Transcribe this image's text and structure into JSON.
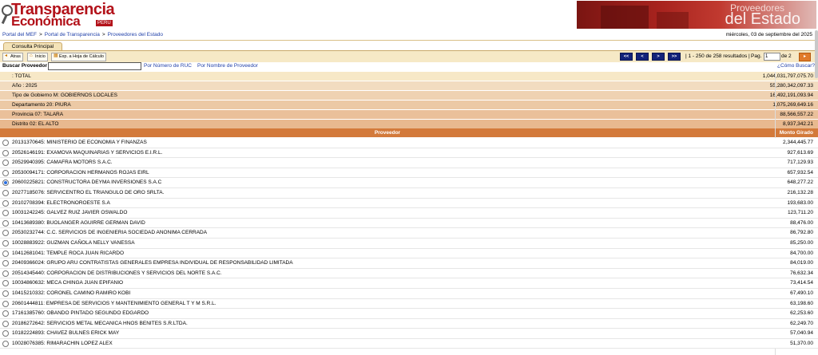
{
  "logo": {
    "line1": "Transparencia",
    "line2": "Económica",
    "tag": "PERU"
  },
  "banner": {
    "line1": "Proveedores",
    "line2": "del Estado"
  },
  "breadcrumb": {
    "items": [
      "Portal del MEF",
      "Portal de Transparencia",
      "Proveedores del Estado"
    ],
    "separator": ">"
  },
  "date": "miércoles, 03 de septiembre del 2025",
  "tab_label": "Consulta Principal",
  "toolbar": {
    "back_label": "Atras",
    "home_label": "Inicio",
    "export_label": "Exp. a Hoja de Cálculo",
    "first": "<<",
    "prev": "<",
    "next": ">",
    "last": ">>",
    "range_text": "| 1 - 250 de 258 resultados |",
    "page_label": "Pag.",
    "page_value": "1",
    "page_of": "de 2",
    "go_icon": "▸"
  },
  "search": {
    "label": "Buscar Proveedor",
    "value": "",
    "by_ruc": "Por Número de RUC",
    "by_name": "Por Nombre de Proveedor",
    "help": "¿Cómo Buscar?"
  },
  "summary": [
    {
      "label": ": TOTAL",
      "amount": "1,044,031,797,075.70",
      "color": "#f7e8c7"
    },
    {
      "label": "Año : 2025",
      "amount": "55,280,342,097.33",
      "color": "#f2dcc0"
    },
    {
      "label": "Tipo de Gobierno M: GOBIERNOS LOCALES",
      "amount": "16,492,191,093.94",
      "color": "#efd2b2"
    },
    {
      "label": "Departamento 20: PIURA",
      "amount": "1,075,269,649.16",
      "color": "#ecc9a5"
    },
    {
      "label": "Provincia 07: TALARA",
      "amount": "88,566,557.22",
      "color": "#eac09a"
    },
    {
      "label": "Distrito 02: EL ALTO",
      "amount": "8,937,342.21",
      "color": "#e8b98f"
    }
  ],
  "table": {
    "headers": {
      "provider": "Proveedor",
      "amount": "Monto Girado"
    },
    "rows": [
      {
        "name": "20131370645: MINISTERIO DE ECONOMIA Y FINANZAS",
        "amount": "2,344,445.77",
        "selected": false
      },
      {
        "name": "20526146191: EXAMOVA MAQUINARIAS Y SERVICIOS E.I.R.L.",
        "amount": "927,613.69",
        "selected": false
      },
      {
        "name": "20529940395: CAMAFRA MOTORS S.A.C.",
        "amount": "717,129.93",
        "selected": false
      },
      {
        "name": "20530094171: CORPORACION HERMANOS ROJAS EIRL",
        "amount": "657,932.54",
        "selected": false
      },
      {
        "name": "20600225821: CONSTRUCTORA DEYMA INVERSIONES S.A.C",
        "amount": "648,277.22",
        "selected": true
      },
      {
        "name": "20277185076: SERVICENTRO EL TRIANGULO DE ORO SRLTA.",
        "amount": "216,132.28",
        "selected": false
      },
      {
        "name": "20102708394: ELECTRONOROESTE S.A",
        "amount": "193,683.00",
        "selected": false
      },
      {
        "name": "10031242245: GALVEZ RUIZ JAVIER OSWALDO",
        "amount": "123,711.20",
        "selected": false
      },
      {
        "name": "10413689380: BUOLANGER AGUIRRE GERMAN DAVID",
        "amount": "88,476.00",
        "selected": false
      },
      {
        "name": "20530232744: C.C. SERVICIOS DE INGENIERIA SOCIEDAD ANONIMA CERRADA",
        "amount": "86,792.80",
        "selected": false
      },
      {
        "name": "10028883922: GUZMAN CAÑOLA NELLY VANESSA",
        "amount": "85,250.00",
        "selected": false
      },
      {
        "name": "10412681041: TEMPLE ROCA JUAN RICARDO",
        "amount": "84,700.00",
        "selected": false
      },
      {
        "name": "20409366024: GRUPO ARU CONTRATISTAS GENERALES EMPRESA INDIVIDUAL DE RESPONSABILIDAD LIMITADA",
        "amount": "84,019.00",
        "selected": false
      },
      {
        "name": "20514345440: CORPORACION DE DISTRIBUCIONES Y SERVICIOS DEL NORTE S.A.C.",
        "amount": "76,632.34",
        "selected": false
      },
      {
        "name": "10034860632: MECA CHINGA JUAN EPIFANIO",
        "amount": "73,414.54",
        "selected": false
      },
      {
        "name": "10415210332: CORONEL CAMINO RAMIRO KOBI",
        "amount": "67,490.10",
        "selected": false
      },
      {
        "name": "20601444811: EMPRESA DE SERVICIOS Y MANTENIMIENTO GENERAL T Y M S.R.L.",
        "amount": "63,198.60",
        "selected": false
      },
      {
        "name": "17161385760: OBANDO PINTADO SEGUNDO EDGARDO",
        "amount": "62,253.60",
        "selected": false
      },
      {
        "name": "20186272642: SERVICIOS METAL MECANICA HNOS BENITES S.R.LTDA.",
        "amount": "62,249.70",
        "selected": false
      },
      {
        "name": "10182224893: CHAVEZ BULNES ERICK MAY",
        "amount": "57,040.94",
        "selected": false
      },
      {
        "name": "10028076385: RIMARACHIN LOPEZ ALEX",
        "amount": "51,370.00",
        "selected": false
      }
    ]
  }
}
